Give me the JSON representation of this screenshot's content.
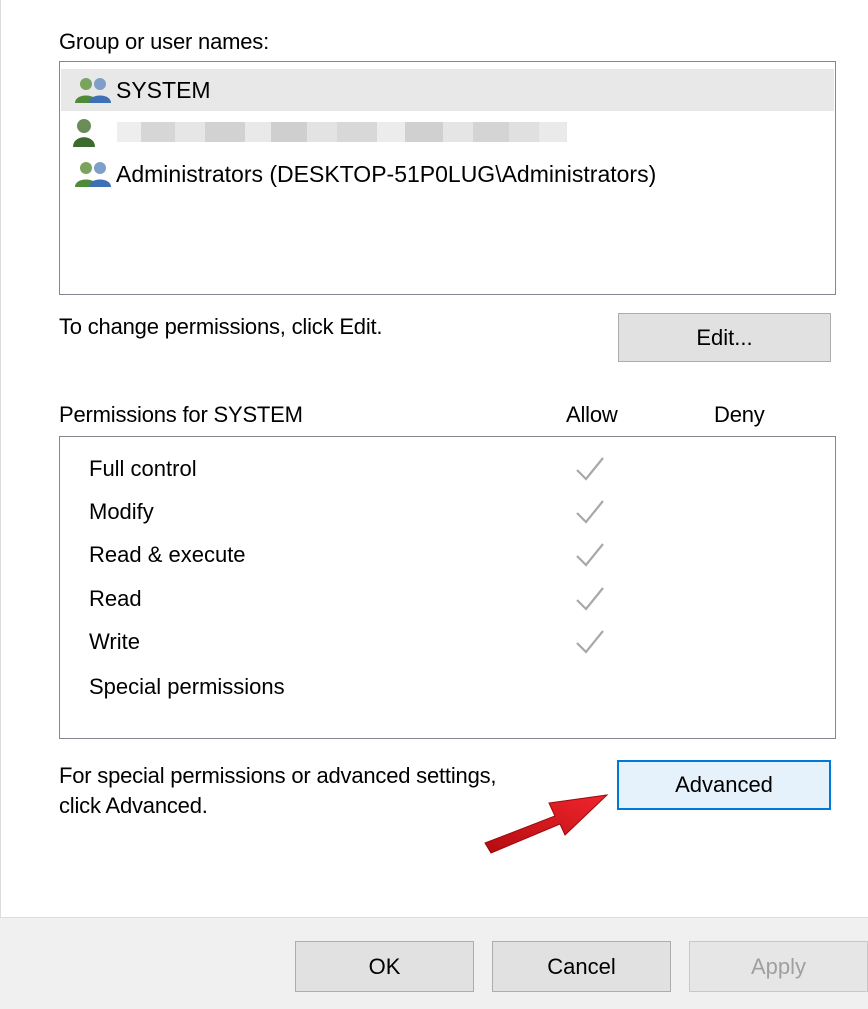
{
  "group_label": "Group or user names:",
  "users": [
    {
      "name": "SYSTEM",
      "icon": "user-group-icon",
      "selected": true
    },
    {
      "name": "",
      "icon": "user-icon",
      "redacted": true
    },
    {
      "name": "Administrators (DESKTOP-51P0LUG\\Administrators)",
      "icon": "user-group-icon",
      "selected": false
    }
  ],
  "change_hint": "To change permissions, click Edit.",
  "edit_button": "Edit...",
  "permissions_for": "Permissions for SYSTEM",
  "allow_header": "Allow",
  "deny_header": "Deny",
  "permissions": [
    {
      "name": "Full control",
      "allow": true,
      "deny": false
    },
    {
      "name": "Modify",
      "allow": true,
      "deny": false
    },
    {
      "name": "Read & execute",
      "allow": true,
      "deny": false
    },
    {
      "name": "Read",
      "allow": true,
      "deny": false
    },
    {
      "name": "Write",
      "allow": true,
      "deny": false
    },
    {
      "name": "Special permissions",
      "allow": false,
      "deny": false
    }
  ],
  "advanced_hint_line1": "For special permissions or advanced settings,",
  "advanced_hint_line2": "click Advanced.",
  "advanced_button": "Advanced",
  "ok_button": "OK",
  "cancel_button": "Cancel",
  "apply_button": "Apply",
  "colors": {
    "focus_border": "#0078d7",
    "arrow": "#e3141b",
    "check": "#a8a8a8"
  }
}
